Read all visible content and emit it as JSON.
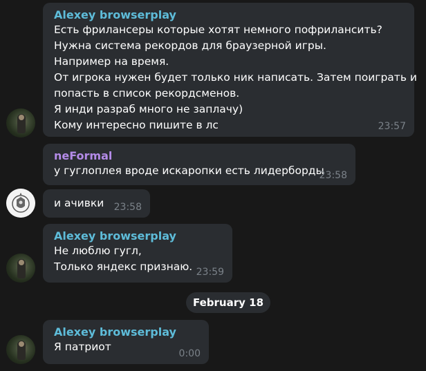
{
  "colors": {
    "alexey_name": "#5ebcd9",
    "neformal_name": "#b48be8",
    "bubble": "#2a2d31",
    "background": "#181818",
    "time": "#7b8289"
  },
  "messages": [
    {
      "sender": "Alexey browserplay",
      "text": "Есть фрилансеры которые хотят немного пофрилансить?\nНужна система рекордов для браузерной игры.\nНапример на время.\nОт игрока нужен будет только ник написать. Затем поиграть и\nпопасть в список рекордсменов.\nЯ инди разраб много не заплачу)\nКому интересно пишите в лс",
      "time": "23:57"
    },
    {
      "sender": "neFormal",
      "text": "у гуглоплея вроде искаропки есть лидерборды",
      "time": "23:58"
    },
    {
      "text": "и ачивки",
      "time": "23:58"
    },
    {
      "sender": "Alexey browserplay",
      "text": "Не люблю гугл,\nТолько яндекс признаю.",
      "time": "23:59"
    },
    {
      "sender": "Alexey browserplay",
      "text": "Я патриот",
      "time": "0:00"
    }
  ],
  "date_separator": "February 18",
  "avatars": {
    "alexey": "user-photo-avatar",
    "neformal": "emblem-avatar"
  }
}
